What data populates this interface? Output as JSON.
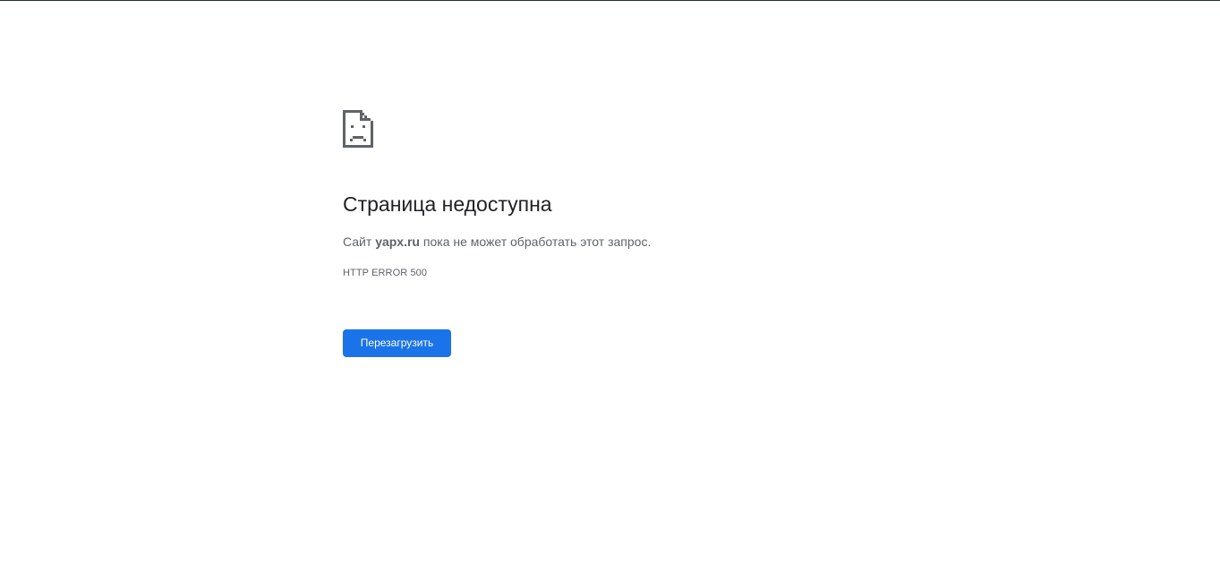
{
  "theme": {
    "accent": "#1a73e8",
    "text_primary": "#202124",
    "text_secondary": "#5f6368"
  },
  "icon": "sad-document-icon",
  "title": "Страница недоступна",
  "message": {
    "prefix": "Сайт ",
    "host": "yapx.ru",
    "suffix": " пока не может обработать этот запрос."
  },
  "error_code": "HTTP ERROR 500",
  "reload_button_label": "Перезагрузить"
}
